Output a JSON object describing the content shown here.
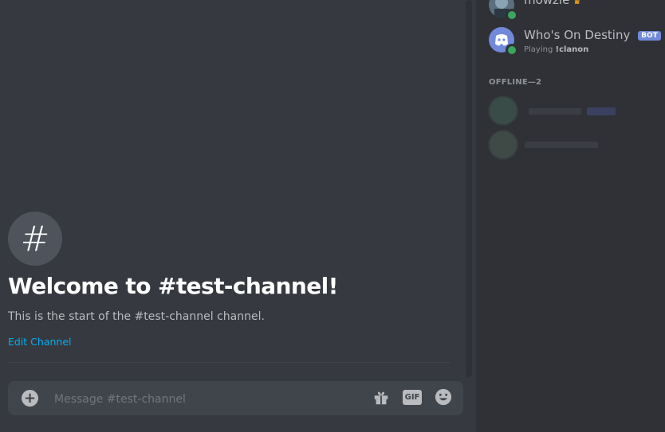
{
  "channel": {
    "hash_symbol": "#",
    "welcome_title": "Welcome to #test-channel!",
    "welcome_description": "This is the start of the #test-channel channel.",
    "edit_label": "Edit Channel"
  },
  "composer": {
    "add_icon": "plus-circle-icon",
    "placeholder": "Message #test-channel",
    "gift_icon": "gift-icon",
    "gif_label": "GIF",
    "emoji_icon": "smiley-icon"
  },
  "members": {
    "online": [
      {
        "name": "mowzie",
        "status": "online",
        "badge_icon": "crown-icon"
      },
      {
        "name": "Who's On Destiny",
        "badge": "BOT",
        "activity_prefix": "Playing",
        "activity_name": "!clanon",
        "status": "online",
        "avatar_icon": "discord-logo-icon"
      }
    ],
    "offline_header": "OFFLINE—2",
    "offline_count": 2
  },
  "colors": {
    "chat_bg": "#36393f",
    "member_bg": "#2f3136",
    "accent": "#00aff4",
    "online": "#3ba55d",
    "bot": "#7289da"
  }
}
